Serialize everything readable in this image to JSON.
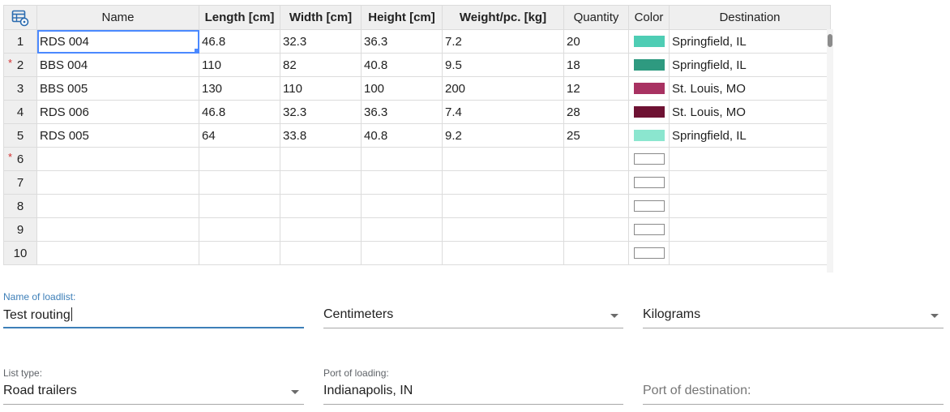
{
  "grid": {
    "columns": [
      "Name",
      "Length [cm]",
      "Width [cm]",
      "Height [cm]",
      "Weight/pc. [kg]",
      "Quantity",
      "Color",
      "Destination"
    ],
    "rows": [
      {
        "num": "1",
        "required": false,
        "name": "RDS 004",
        "length": "46.8",
        "width": "32.3",
        "height": "36.3",
        "weight": "7.2",
        "quantity": "20",
        "color": "#4ecdb4",
        "destination": "Springfield, IL"
      },
      {
        "num": "2",
        "required": true,
        "name": "BBS 004",
        "length": "110",
        "width": "82",
        "height": "40.8",
        "weight": "9.5",
        "quantity": "18",
        "color": "#2e9a80",
        "destination": "Springfield, IL"
      },
      {
        "num": "3",
        "required": false,
        "name": "BBS 005",
        "length": "130",
        "width": "110",
        "height": "100",
        "weight": "200",
        "quantity": "12",
        "color": "#a83262",
        "destination": "St. Louis, MO"
      },
      {
        "num": "4",
        "required": false,
        "name": "RDS 006",
        "length": "46.8",
        "width": "32.3",
        "height": "36.3",
        "weight": "7.4",
        "quantity": "28",
        "color": "#6e1233",
        "destination": "St. Louis, MO"
      },
      {
        "num": "5",
        "required": false,
        "name": "RDS 005",
        "length": "64",
        "width": "33.8",
        "height": "40.8",
        "weight": "9.2",
        "quantity": "25",
        "color": "#8be6cf",
        "destination": "Springfield, IL"
      },
      {
        "num": "6",
        "required": true,
        "name": "",
        "length": "",
        "width": "",
        "height": "",
        "weight": "",
        "quantity": "",
        "color": "#ffffff",
        "destination": ""
      },
      {
        "num": "7",
        "required": false,
        "name": "",
        "length": "",
        "width": "",
        "height": "",
        "weight": "",
        "quantity": "",
        "color": "#ffffff",
        "destination": ""
      },
      {
        "num": "8",
        "required": false,
        "name": "",
        "length": "",
        "width": "",
        "height": "",
        "weight": "",
        "quantity": "",
        "color": "#ffffff",
        "destination": ""
      },
      {
        "num": "9",
        "required": false,
        "name": "",
        "length": "",
        "width": "",
        "height": "",
        "weight": "",
        "quantity": "",
        "color": "#ffffff",
        "destination": ""
      },
      {
        "num": "10",
        "required": false,
        "name": "",
        "length": "",
        "width": "",
        "height": "",
        "weight": "",
        "quantity": "",
        "color": "#ffffff",
        "destination": ""
      }
    ],
    "required_marker": "*",
    "corner_icon": "table-settings-icon"
  },
  "form": {
    "loadlist_name": {
      "label": "Name of loadlist:",
      "value": "Test routing"
    },
    "length_unit": {
      "value": "Centimeters"
    },
    "weight_unit": {
      "value": "Kilograms"
    },
    "list_type": {
      "label": "List type:",
      "value": "Road trailers"
    },
    "port_loading": {
      "label": "Port of loading:",
      "value": "Indianapolis, IN"
    },
    "port_destination": {
      "placeholder": "Port of destination:"
    }
  },
  "colors": {
    "accent": "#3d7fb8",
    "selection": "#4b89ff",
    "required": "#d32f2f"
  }
}
